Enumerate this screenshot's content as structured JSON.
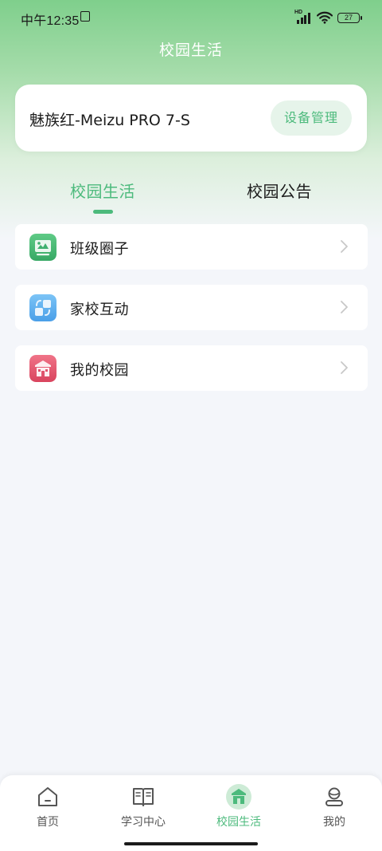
{
  "status_bar": {
    "time": "中午12:35",
    "network_label": "HD",
    "battery": "27"
  },
  "header": {
    "title": "校园生活"
  },
  "device_card": {
    "device_name": "魅族红-Meizu PRO 7-S",
    "manage_label": "设备管理"
  },
  "tabs": [
    {
      "label": "校园生活",
      "active": true
    },
    {
      "label": "校园公告",
      "active": false
    }
  ],
  "list": [
    {
      "label": "班级圈子",
      "icon": "class-circle-icon",
      "color": "#4cba7c"
    },
    {
      "label": "家校互动",
      "icon": "home-school-icon",
      "color": "#5aaaf0"
    },
    {
      "label": "我的校园",
      "icon": "my-campus-icon",
      "color": "#e8566e"
    }
  ],
  "bottom_nav": [
    {
      "label": "首页",
      "icon": "home-icon",
      "active": false
    },
    {
      "label": "学习中心",
      "icon": "book-icon",
      "active": false
    },
    {
      "label": "校园生活",
      "icon": "campus-icon",
      "active": true
    },
    {
      "label": "我的",
      "icon": "profile-icon",
      "active": false
    }
  ],
  "colors": {
    "accent": "#4cba7c",
    "header_gradient_top": "#7fcf8c",
    "background": "#f4f6fa"
  }
}
